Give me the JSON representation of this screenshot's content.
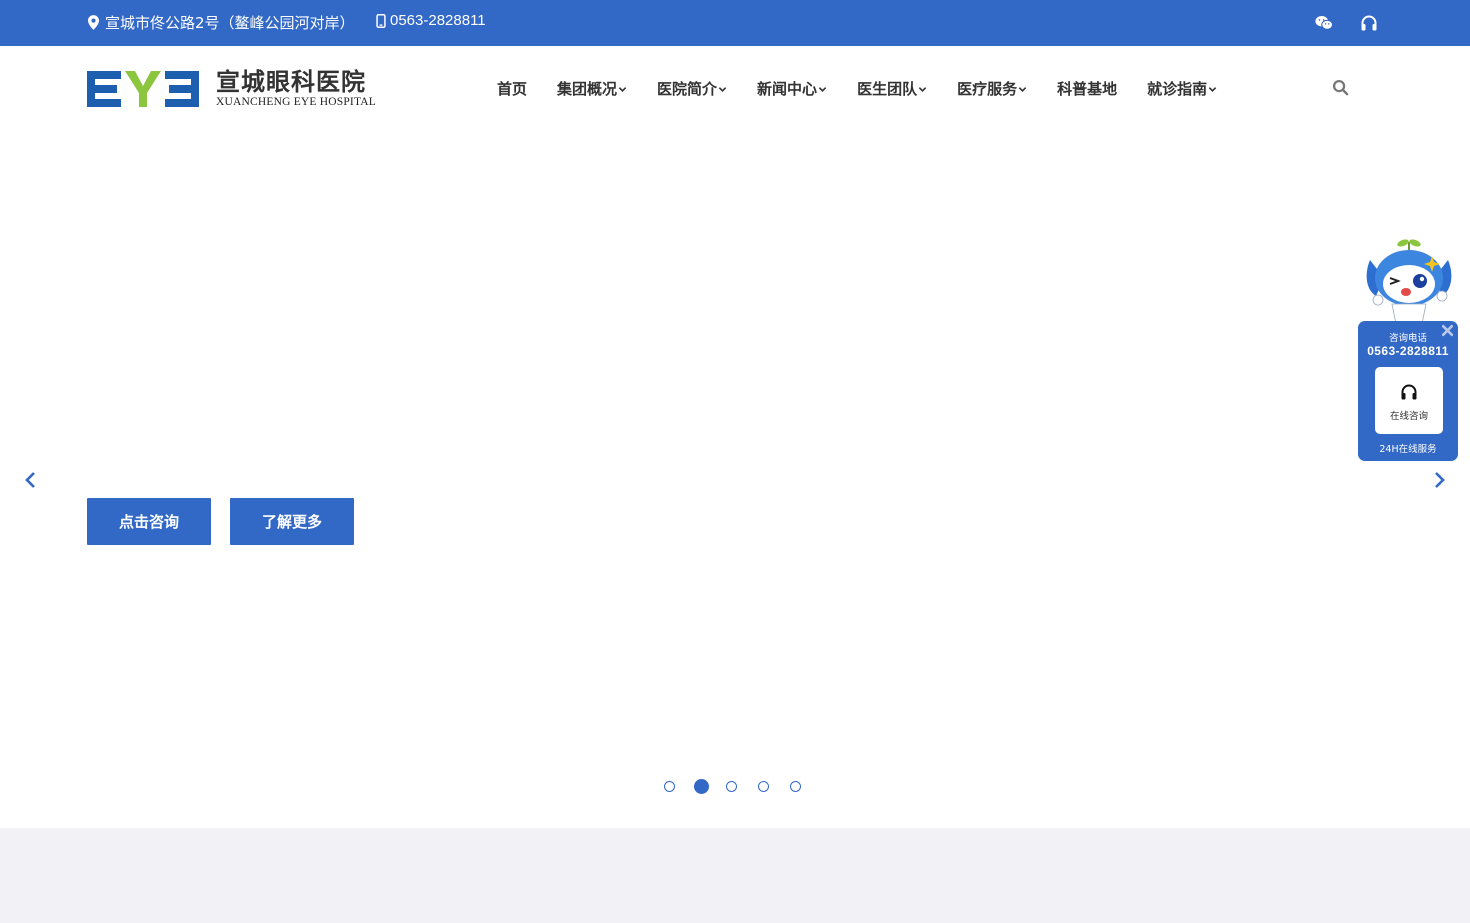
{
  "topbar": {
    "address": "宣城市佟公路2号（鳌峰公园河对岸）",
    "phone": "0563-2828811",
    "icons": [
      "location-icon",
      "mobile-icon",
      "wechat-icon",
      "headphones-icon"
    ]
  },
  "header": {
    "logo_cn": "宣城眼科医院",
    "logo_en": "XUANCHENG EYE HOSPITAL",
    "nav": [
      {
        "label": "首页",
        "dropdown": false
      },
      {
        "label": "集团概况",
        "dropdown": true
      },
      {
        "label": "医院简介",
        "dropdown": true
      },
      {
        "label": "新闻中心",
        "dropdown": true
      },
      {
        "label": "医生团队",
        "dropdown": true
      },
      {
        "label": "医疗服务",
        "dropdown": true
      },
      {
        "label": "科普基地",
        "dropdown": false
      },
      {
        "label": "就诊指南",
        "dropdown": true
      }
    ]
  },
  "banner": {
    "consult_button": "点击咨询",
    "more_button": "了解更多",
    "slide_count": 5,
    "active_slide": 2
  },
  "float_widget": {
    "label": "咨询电话",
    "phone": "0563-2828811",
    "online": "在线咨询",
    "service": "24H在线服务"
  },
  "colors": {
    "brand_blue": "#3268c6",
    "logo_green": "#8cc63f",
    "logo_blue": "#1b5fae",
    "text_dark": "#333333",
    "footer_bg": "#f1f1f6"
  }
}
